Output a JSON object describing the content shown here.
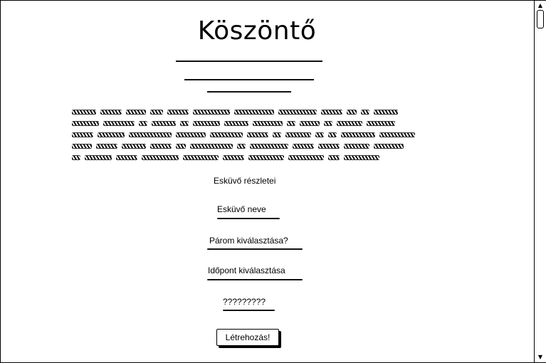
{
  "page": {
    "title": "Köszöntő"
  },
  "form": {
    "section_label": "Esküvő részletei",
    "wedding_name": "Esküvő neve",
    "choose_partner": "Párom kiválasztása?",
    "choose_date": "Időpont kiválasztása",
    "unknown_field": "?????????",
    "submit_label": "Létrehozás!"
  },
  "icons": {
    "scroll_up": "triangle-up-icon",
    "scroll_down": "triangle-down-icon"
  }
}
